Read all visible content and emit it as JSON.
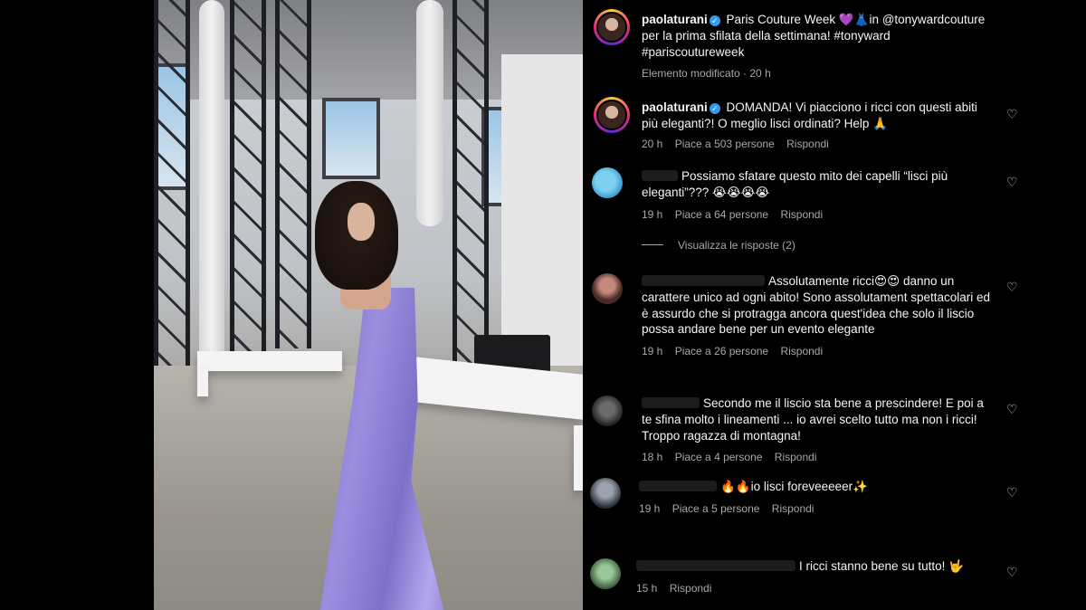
{
  "post": {
    "author": "paolaturani",
    "caption": "Paris Couture Week 💜👗in @tonywardcouture per la prima sfilata della settimana! #tonyward #pariscoutureweek",
    "meta": "Elemento modificato · 20 h"
  },
  "comments": [
    {
      "user": "paolaturani",
      "verified": true,
      "text": "DOMANDA! Vi piacciono i ricci con questi abiti più eleganti?! O meglio lisci ordinati? Help 🙏",
      "time": "20 h",
      "likes": "Piace a 503 persone",
      "reply": "Rispondi"
    },
    {
      "user": "",
      "text": "Possiamo sfatare questo mito dei capelli “lisci più eleganti”??? 😭😭😭😭",
      "time": "19 h",
      "likes": "Piace a 64 persone",
      "reply": "Rispondi",
      "view_replies": "Visualizza le risposte (2)"
    },
    {
      "user": "",
      "text": "Assolutamente ricci😍😍 danno un carattere unico ad ogni abito! Sono assolutament spettacolari ed è assurdo che si protragga ancora quest'idea che solo il liscio possa andare bene per un evento elegante",
      "time": "19 h",
      "likes": "Piace a 26 persone",
      "reply": "Rispondi"
    },
    {
      "user": "",
      "text": "Secondo me il liscio sta bene a prescindere! E poi a te sfina molto i lineamenti ... io avrei scelto tutto ma non i ricci! Troppo ragazza di montagna!",
      "time": "18 h",
      "likes": "Piace a 4 persone",
      "reply": "Rispondi"
    },
    {
      "user": "",
      "text": "🔥🔥io lisci foreveeeeer✨",
      "time": "19 h",
      "likes": "Piace a 5 persone",
      "reply": "Rispondi"
    },
    {
      "user": "",
      "text": "I ricci stanno bene su tutto! 🤟",
      "time": "15 h",
      "reply": "Rispondi"
    }
  ],
  "icons": {
    "like": "heart-outline-icon",
    "verified": "verified-badge-icon"
  },
  "colors": {
    "background": "#000000",
    "meta_text": "#a8a8a8",
    "verified": "#3897f0",
    "dress": "#8f81d6"
  }
}
